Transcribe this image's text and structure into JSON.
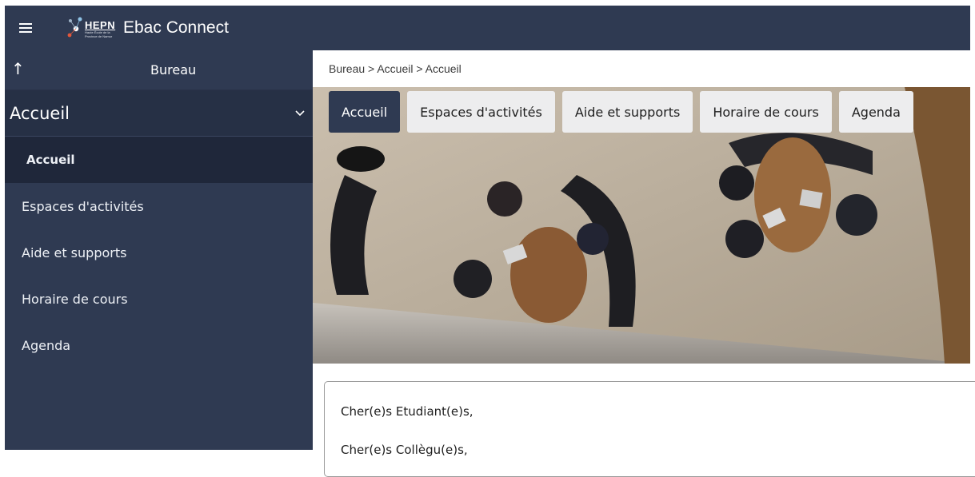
{
  "header": {
    "app_title": "Ebac Connect",
    "logo_text": "HEPN",
    "logo_subtext": "Haute École de la Province de Namur",
    "menu_icon": "hamburger-menu-icon"
  },
  "sidebar": {
    "up_icon": "arrow-up-icon",
    "top_label": "Bureau",
    "section_label": "Accueil",
    "items": [
      {
        "label": "Accueil",
        "active": true
      },
      {
        "label": "Espaces d'activités",
        "active": false
      },
      {
        "label": "Aide et supports",
        "active": false
      },
      {
        "label": "Horaire de cours",
        "active": false
      },
      {
        "label": "Agenda",
        "active": false
      }
    ]
  },
  "breadcrumb": {
    "text": "Bureau  >  Accueil  >  Accueil"
  },
  "tabs": [
    {
      "label": "Accueil",
      "active": true
    },
    {
      "label": "Espaces d'activités",
      "active": false
    },
    {
      "label": "Aide et supports",
      "active": false
    },
    {
      "label": "Horaire de cours",
      "active": false
    },
    {
      "label": "Agenda",
      "active": false
    }
  ],
  "content": {
    "greeting_1": "Cher(e)s Etudiant(e)s,",
    "greeting_2": "Cher(e)s Collègu(e)s,"
  },
  "colors": {
    "nav_bg": "#2f3a52",
    "nav_active": "#1f273a",
    "tab_bg": "#ededee"
  }
}
